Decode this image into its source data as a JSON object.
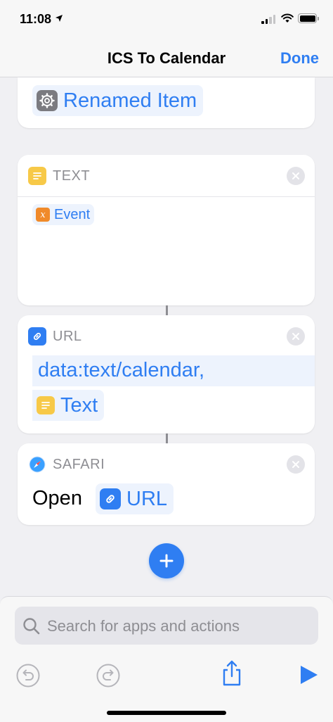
{
  "status_bar": {
    "time": "11:08"
  },
  "nav": {
    "title": "ICS To Calendar",
    "done_label": "Done"
  },
  "actions": [
    {
      "type": "partial",
      "variable_label": "Renamed Item",
      "variable_icon": "gear-icon"
    },
    {
      "type": "text",
      "label": "TEXT",
      "icon": "text-document-icon",
      "variable_label": "Event",
      "variable_icon": "variable-x-icon"
    },
    {
      "type": "url",
      "label": "URL",
      "icon": "link-icon",
      "url_prefix": "data:text/calendar,",
      "variable_label": "Text",
      "variable_icon": "text-document-icon"
    },
    {
      "type": "safari",
      "label": "SAFARI",
      "icon": "safari-compass-icon",
      "open_label": "Open",
      "variable_label": "URL",
      "variable_icon": "link-icon"
    }
  ],
  "search": {
    "placeholder": "Search for apps and actions"
  },
  "colors": {
    "accent": "#2f7ef2",
    "text_icon_yellow": "#f7c948",
    "variable_orange": "#f08a2a",
    "gear_gray": "#7b7b80",
    "background": "#f0f0f3"
  }
}
